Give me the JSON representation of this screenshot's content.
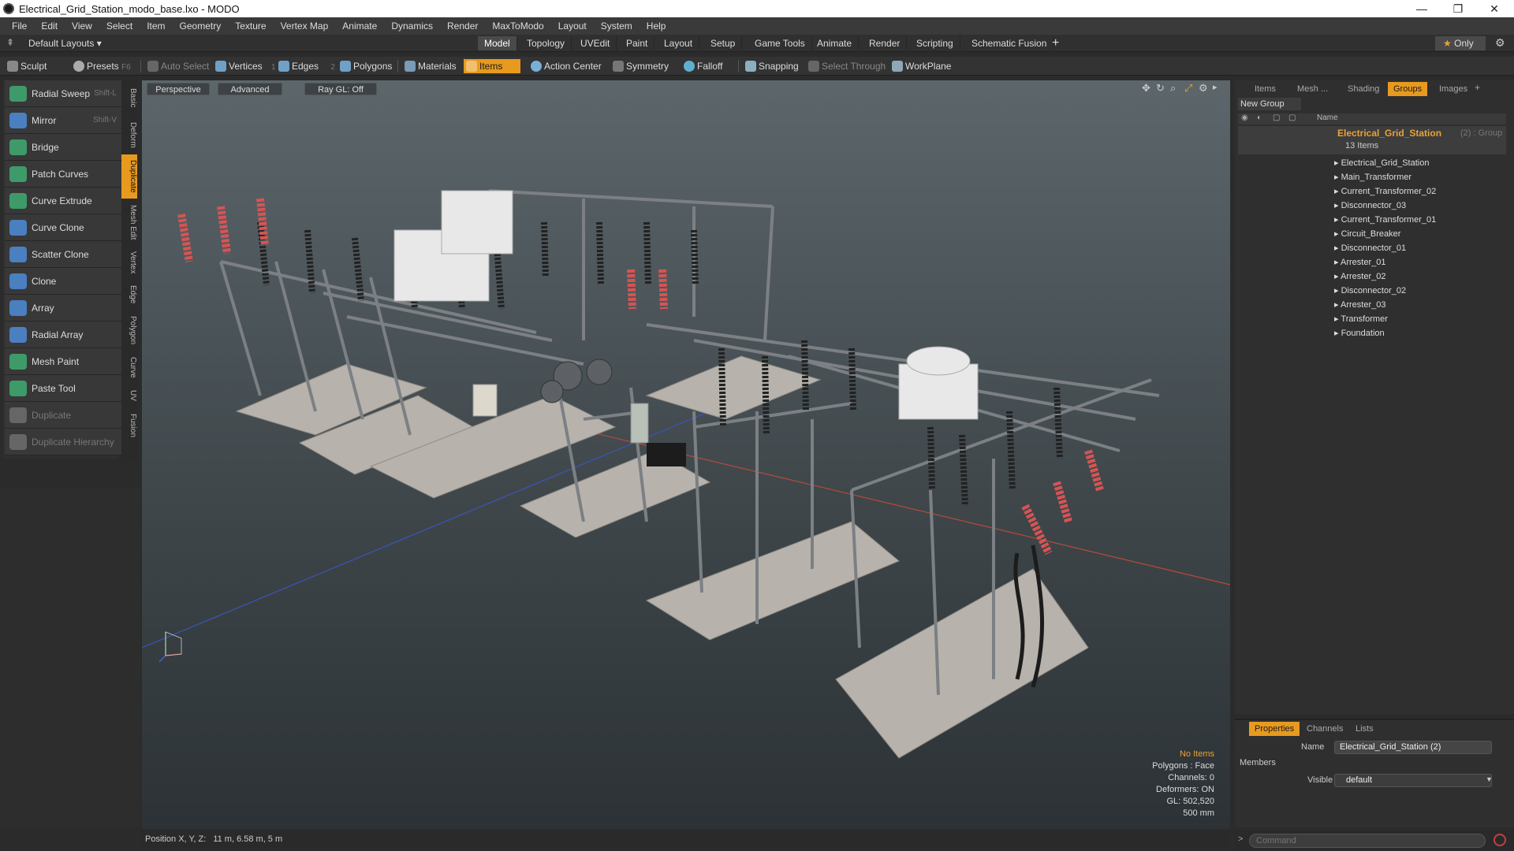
{
  "window": {
    "title": "Electrical_Grid_Station_modo_base.lxo - MODO"
  },
  "menu": [
    "File",
    "Edit",
    "View",
    "Select",
    "Item",
    "Geometry",
    "Texture",
    "Vertex Map",
    "Animate",
    "Dynamics",
    "Render",
    "MaxToModo",
    "Layout",
    "System",
    "Help"
  ],
  "layout": {
    "preset": "Default Layouts ▾",
    "tabs": [
      "Model",
      "Topology",
      "UVEdit",
      "Paint",
      "Layout",
      "Setup",
      "Game Tools",
      "Animate",
      "Render",
      "Scripting",
      "Schematic Fusion"
    ],
    "active": "Model",
    "only_label": "Only"
  },
  "toolbar": {
    "sculpt": "Sculpt",
    "presets": "Presets",
    "presets_key": "F6",
    "auto_select": "Auto Select",
    "vertices": "Vertices",
    "vertices_count": "1",
    "edges": "Edges",
    "edges_count": "2",
    "polygons": "Polygons",
    "materials": "Materials",
    "items": "Items",
    "action_center": "Action Center",
    "symmetry": "Symmetry",
    "falloff": "Falloff",
    "snapping": "Snapping",
    "select_through": "Select Through",
    "workplane": "WorkPlane"
  },
  "tools": [
    {
      "label": "Radial Sweep",
      "shortcut": "Shift-L",
      "color": "#3f9a6a"
    },
    {
      "label": "Mirror",
      "shortcut": "Shift-V",
      "color": "#4a7fc0"
    },
    {
      "label": "Bridge",
      "shortcut": "",
      "color": "#3f9a6a"
    },
    {
      "label": "Patch Curves",
      "shortcut": "",
      "color": "#3f9a6a"
    },
    {
      "label": "Curve Extrude",
      "shortcut": "",
      "color": "#3f9a6a"
    },
    {
      "label": "Curve Clone",
      "shortcut": "",
      "color": "#4a7fc0"
    },
    {
      "label": "Scatter Clone",
      "shortcut": "",
      "color": "#4a7fc0"
    },
    {
      "label": "Clone",
      "shortcut": "",
      "color": "#4a7fc0"
    },
    {
      "label": "Array",
      "shortcut": "",
      "color": "#4a7fc0"
    },
    {
      "label": "Radial Array",
      "shortcut": "",
      "color": "#4a7fc0"
    },
    {
      "label": "Mesh Paint",
      "shortcut": "",
      "color": "#3f9a6a"
    },
    {
      "label": "Paste Tool",
      "shortcut": "",
      "color": "#3f9a6a"
    },
    {
      "label": "Duplicate",
      "shortcut": "",
      "color": "#666666"
    },
    {
      "label": "Duplicate Hierarchy",
      "shortcut": "",
      "color": "#666666"
    }
  ],
  "vtabs": [
    "Basic",
    "Deform",
    "Duplicate",
    "Mesh Edit",
    "Vertex",
    "Edge",
    "Polygon",
    "Curve",
    "UV",
    "Fusion"
  ],
  "vtab_active": "Duplicate",
  "viewport": {
    "view": "Perspective",
    "shading": "Advanced",
    "raygl": "Ray GL: Off",
    "info": {
      "no_items": "No Items",
      "polygons": "Polygons : Face",
      "channels": "Channels: 0",
      "deformers": "Deformers: ON",
      "gl": "GL: 502,520",
      "scale": "500 mm"
    }
  },
  "status": {
    "position_label": "Position X, Y, Z:",
    "position_value": "11 m, 6.58 m, 5 m"
  },
  "panel": {
    "tabs": [
      "Items",
      "Mesh ...",
      "Shading",
      "Groups",
      "Images"
    ],
    "active_tab": "Groups",
    "new_group": "New Group",
    "name_col": "Name",
    "group": {
      "name": "Electrical_Grid_Station",
      "suffix": "(2) : Group",
      "count": "13 Items"
    },
    "items": [
      "Electrical_Grid_Station",
      "Main_Transformer",
      "Current_Transformer_02",
      "Disconnector_03",
      "Current_Transformer_01",
      "Circuit_Breaker",
      "Disconnector_01",
      "Arrester_01",
      "Arrester_02",
      "Disconnector_02",
      "Arrester_03",
      "Transformer",
      "Foundation"
    ]
  },
  "properties": {
    "tabs": [
      "Properties",
      "Channels",
      "Lists"
    ],
    "active_tab": "Properties",
    "name_label": "Name",
    "name_value": "Electrical_Grid_Station (2)",
    "members": "Members",
    "visible_label": "Visible",
    "visible_value": "default"
  },
  "command": {
    "placeholder": "Command"
  }
}
